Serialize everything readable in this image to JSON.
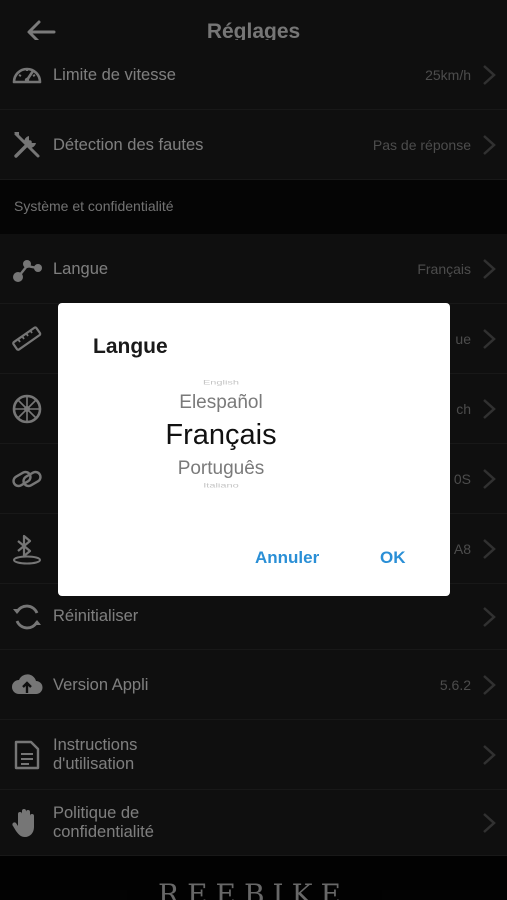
{
  "header": {
    "title": "Réglages"
  },
  "rows": [
    {
      "label": "Limite de vitesse",
      "value": "25km/h"
    },
    {
      "label": "Détection des fautes",
      "value": "Pas de réponse"
    },
    {
      "label": "Langue",
      "value": "Français"
    },
    {
      "label": "",
      "value": ""
    },
    {
      "label": "",
      "value": ""
    },
    {
      "label": "",
      "value": ""
    },
    {
      "label": "",
      "value": ""
    },
    {
      "label": "Réinitialiser",
      "value": ""
    },
    {
      "label": "Version Appli",
      "value": "5.6.2"
    },
    {
      "label_line1": "Instructions",
      "label_line2": "d'utilisation",
      "value": ""
    },
    {
      "label_line1": "Politique de",
      "label_line2": "confidentialité",
      "value": ""
    }
  ],
  "section": {
    "title": "Système et confidentialité"
  },
  "partial_values": [
    "ue",
    "ch",
    "0S",
    "A8"
  ],
  "footer": {
    "brand": "REEBIKE"
  },
  "dialog": {
    "title": "Langue",
    "options": [
      "English",
      "Elespañol",
      "Français",
      "Português",
      "Italiano"
    ],
    "selected": "Français",
    "cancel_label": "Annuler",
    "ok_label": "OK"
  },
  "colors": {
    "accent": "#2a8fd6",
    "background": "#0c0c0c",
    "row": "#1c1c1c"
  }
}
